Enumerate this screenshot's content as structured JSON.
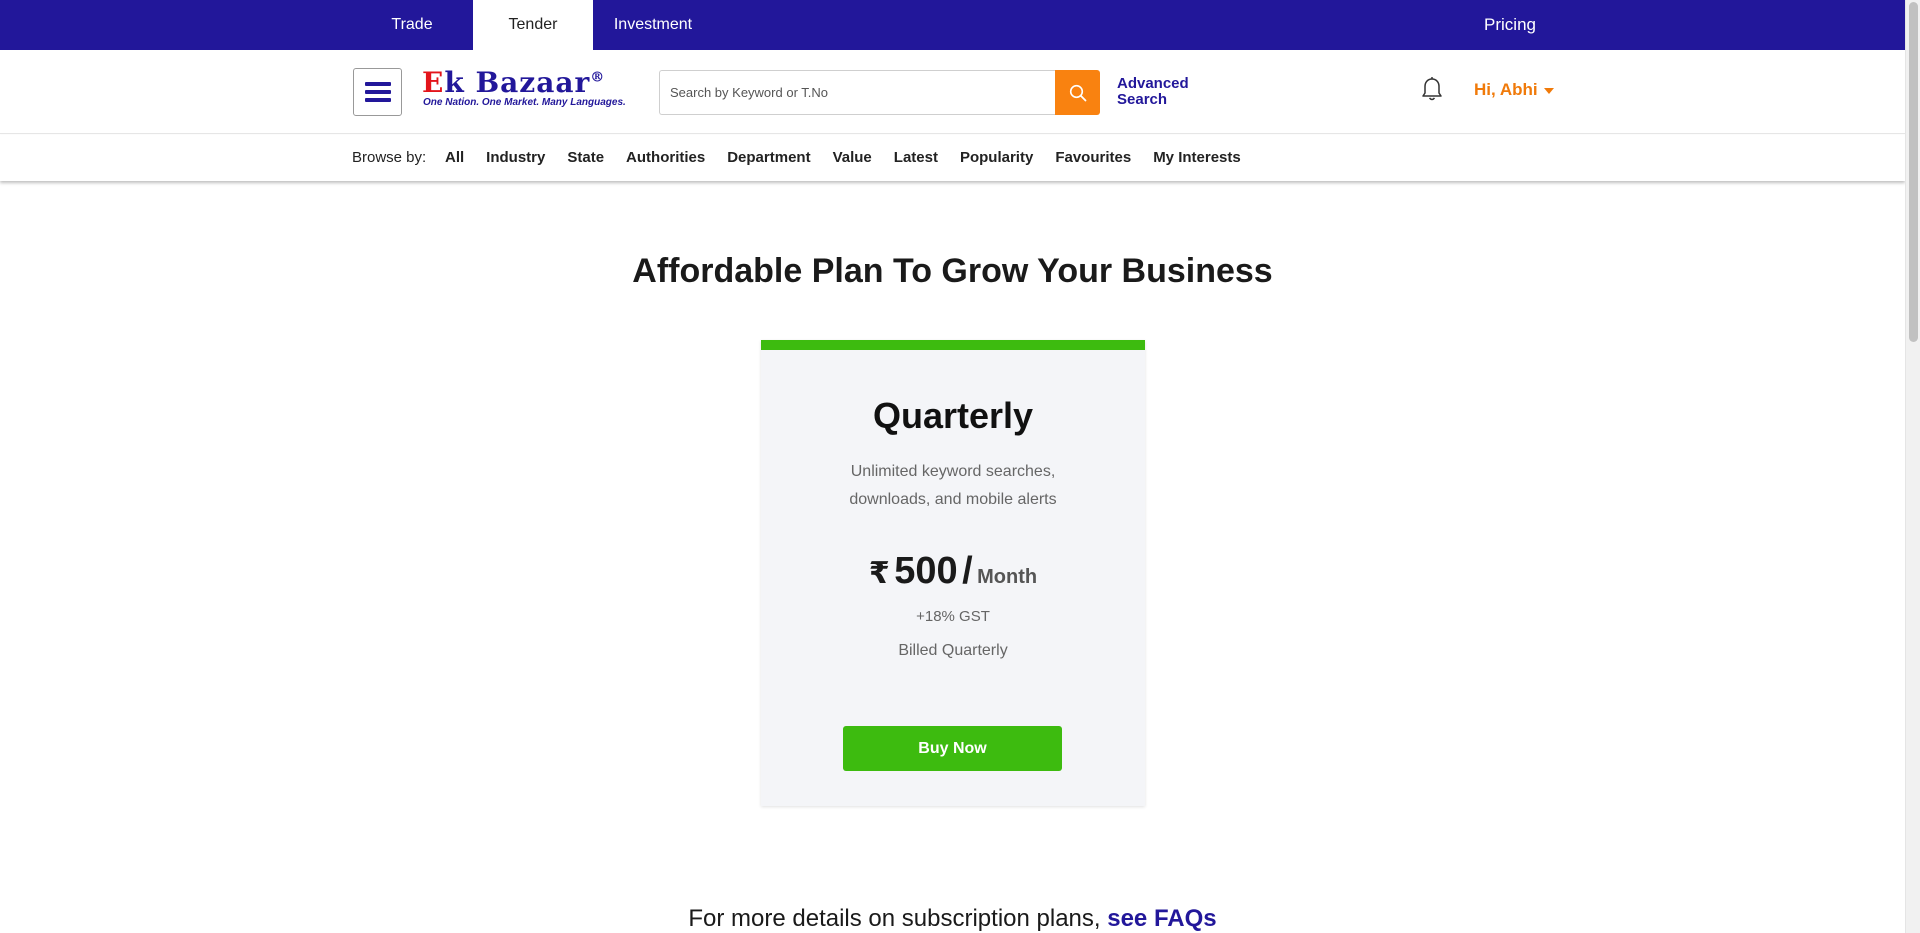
{
  "topbar": {
    "tabs": [
      {
        "label": "Trade",
        "active": false
      },
      {
        "label": "Tender",
        "active": true
      },
      {
        "label": "Investment",
        "active": false
      }
    ],
    "pricing_label": "Pricing"
  },
  "header": {
    "logo": {
      "text_first": "E",
      "text_rest": "k Bazaar",
      "registered": "®",
      "tagline": "One Nation. One Market. Many Languages."
    },
    "search": {
      "placeholder": "Search by Keyword or T.No",
      "value": ""
    },
    "advanced_search_label": "Advanced Search",
    "user_greeting": "Hi, Abhi"
  },
  "browse": {
    "label": "Browse by:",
    "links": [
      "All",
      "Industry",
      "State",
      "Authorities",
      "Department",
      "Value",
      "Latest",
      "Popularity",
      "Favourites",
      "My Interests"
    ]
  },
  "main": {
    "headline": "Affordable Plan To Grow Your Business",
    "plan": {
      "name": "Quarterly",
      "description": "Unlimited keyword searches, downloads, and mobile alerts",
      "currency_symbol": "₹",
      "amount": "500",
      "separator": "/",
      "period": "Month",
      "gst": "+18% GST",
      "billing": "Billed Quarterly",
      "buy_label": "Buy Now"
    },
    "faq": {
      "text": "For more details on subscription plans,",
      "link": "see FAQs"
    }
  },
  "colors": {
    "brand_blue": "#22179a",
    "accent_orange": "#f98210",
    "success_green": "#3dbb0f",
    "logo_red": "#e3141b"
  },
  "icons": {
    "menu": "hamburger-icon",
    "search": "search-icon",
    "notifications": "bell-icon",
    "user_menu": "caret-down-icon"
  }
}
